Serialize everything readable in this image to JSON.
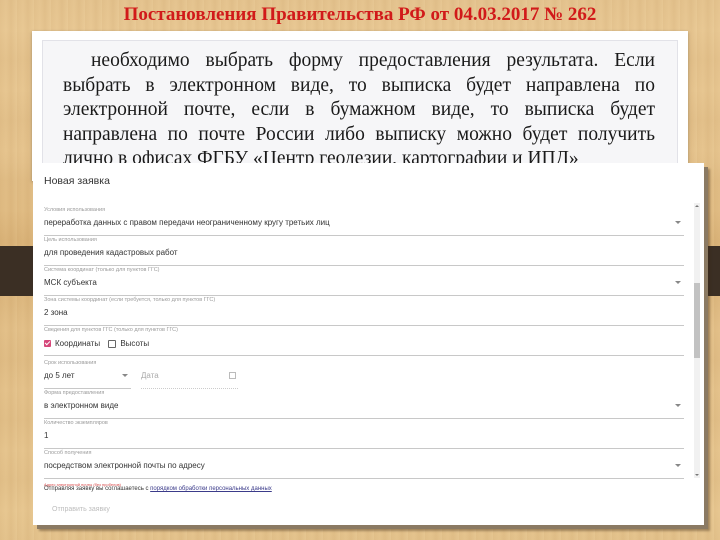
{
  "slide": {
    "title": "Постановления Правительства РФ от 04.03.2017 № 262",
    "paragraph": "необходимо выбрать форму предоставления результата. Если выбрать в электронном виде, то выписка будет направлена по электронной почте, если в бумажном виде, то выписка будет направлена по почте России либо выписку можно будет получить лично в офисах ФГБУ «Центр геодезии, картографии и ИПД»"
  },
  "form": {
    "title": "Новая заявка",
    "fields": [
      {
        "label": "Условия использования",
        "value": "переработка данных с правом передачи неограниченному кругу третьих лиц",
        "dropdown": true
      },
      {
        "label": "Цель использования",
        "value": "для проведения кадастровых работ",
        "dropdown": false
      },
      {
        "label": "Система координат (только для пунктов ГГС)",
        "value": "МСК субъекта",
        "dropdown": true
      },
      {
        "label": "Зона системы координат (если требуется, только для пунктов ГГС)",
        "value": "2 зона",
        "dropdown": false
      }
    ],
    "ggs_info": {
      "label": "Сведения для пунктов ГГС (только для пунктов ГГС)",
      "checkboxes": [
        {
          "label": "Координаты",
          "checked": true
        },
        {
          "label": "Высоты",
          "checked": false
        }
      ]
    },
    "term": {
      "label": "Срок использования",
      "value": "до 5 лет"
    },
    "date": {
      "placeholder": "Дата"
    },
    "fields2": [
      {
        "label": "Форма предоставления",
        "value": "в электронном виде",
        "dropdown": true
      },
      {
        "label": "Количество экземпляров",
        "value": "1",
        "dropdown": false
      },
      {
        "label": "Способ получения",
        "value": "посредством электронной почты по адресу",
        "dropdown": true
      }
    ],
    "email_hint": "Адрес электронной почты (без пробелов)",
    "agree_text": "Отправляя заявку вы соглашаетесь с ",
    "agree_link": "порядком обработки персональных данных",
    "submit_label": "Отправить заявку"
  },
  "colors": {
    "title_red": "#d11a1a",
    "checkbox_accent": "#d6477a"
  }
}
